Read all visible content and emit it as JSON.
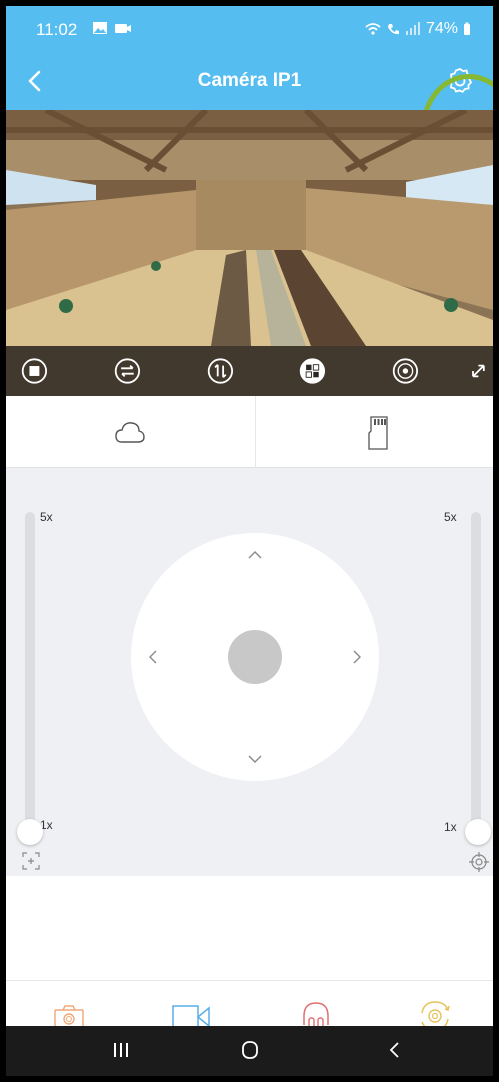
{
  "status": {
    "time": "11:02",
    "battery": "74%"
  },
  "header": {
    "title": "Caméra IP1",
    "back_icon": "chevron-left-icon",
    "settings_icon": "gear-icon"
  },
  "video_controls": [
    "stop-icon",
    "flip-horizontal-icon",
    "flip-vertical-icon",
    "layout-icon",
    "target-icon",
    "fullscreen-icon"
  ],
  "storage": {
    "cloud_icon": "cloud-icon",
    "sd_icon": "sd-card-icon"
  },
  "ptz": {
    "zoom_left": {
      "max_label": "5x",
      "min_label": "1x",
      "level": 0
    },
    "zoom_right": {
      "max_label": "5x",
      "min_label": "1x",
      "level": 0
    }
  },
  "toolbar": [
    "camera-icon",
    "video-record-icon",
    "headphones-icon",
    "rotate-icon"
  ],
  "colors": {
    "header": "#55bdf0",
    "highlight": "#86b832",
    "camera_icon": "#f0a878",
    "record_icon": "#59aee6",
    "headphones_icon": "#e07070",
    "rotate_icon": "#e6c25a"
  }
}
